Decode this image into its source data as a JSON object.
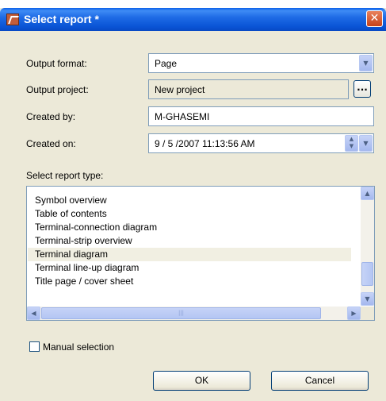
{
  "window": {
    "title": "Select report *",
    "close_glyph": "✕",
    "app_icon": "report-app-icon"
  },
  "form": {
    "output_format": {
      "label": "Output format:",
      "value": "Page"
    },
    "output_project": {
      "label": "Output project:",
      "value": "New project",
      "browse_label": "..."
    },
    "created_by": {
      "label": "Created by:",
      "value": "M-GHASEMI"
    },
    "created_on": {
      "label": "Created on:",
      "value": "9 / 5 /2007 11:13:56 AM"
    }
  },
  "report_list": {
    "label": "Select report type:",
    "items": [
      "Symbol overview",
      "Table of contents",
      "Terminal-connection diagram",
      "Terminal-strip overview",
      "Terminal diagram",
      "Terminal line-up diagram",
      "Title page / cover sheet"
    ],
    "selected_index": 4
  },
  "manual_selection": {
    "label": "Manual selection",
    "checked": false
  },
  "buttons": {
    "ok": "OK",
    "cancel": "Cancel"
  },
  "colors": {
    "titlebar": "#0a55d6",
    "dialog_bg": "#ece9d8",
    "close": "#c8421a"
  }
}
